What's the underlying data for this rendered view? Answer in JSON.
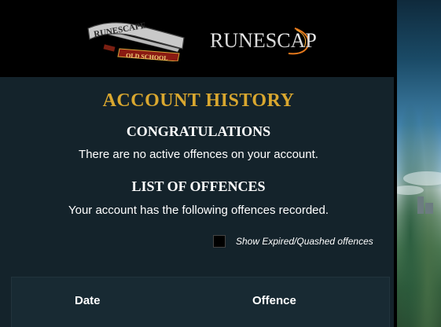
{
  "header": {
    "osrs_logo": {
      "icon": "runescape-old-school-logo",
      "text_top": "RUNESCAPE",
      "text_bottom": "OLD SCHOOL"
    },
    "rs_logo": {
      "icon": "runescape-logo",
      "text": "RUNESCAPE"
    }
  },
  "page": {
    "title": "ACCOUNT HISTORY",
    "congrats_heading": "CONGRATULATIONS",
    "no_offences_text": "There are no active offences on your account.",
    "offences_heading": "LIST OF OFFENCES",
    "recorded_text": "Your account has the following offences recorded."
  },
  "filter": {
    "show_expired_label": "Show Expired/Quashed offences",
    "show_expired_checked": false
  },
  "table": {
    "columns": [
      "Date",
      "Offence"
    ]
  },
  "colors": {
    "panel_bg": "#14232b",
    "header_bg": "#000000",
    "title_gold": "#d9a72f",
    "text": "#ffffff",
    "table_bg": "#182a33"
  }
}
